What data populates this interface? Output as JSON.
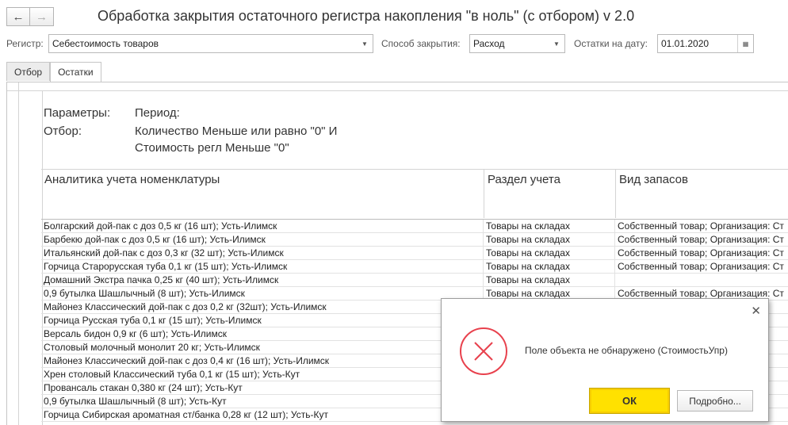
{
  "window": {
    "title": "Обработка закрытия остаточного регистра накопления \"в ноль\" (с отбором) v 2.0",
    "back_icon": "←",
    "forward_icon": "→"
  },
  "form": {
    "register_label": "Регистр:",
    "register_value": "Себестоимость товаров",
    "method_label": "Способ закрытия:",
    "method_value": "Расход",
    "date_label": "Остатки на дату:",
    "date_value": "01.01.2020",
    "dropdown_icon": "▼",
    "calendar_icon": "▦"
  },
  "tabs": [
    {
      "label": "Отбор"
    },
    {
      "label": "Остатки"
    }
  ],
  "report": {
    "params_label": "Параметры:",
    "period_label": "Период:",
    "filter_label": "Отбор:",
    "filter_line1": "Количество Меньше или равно \"0\" И",
    "filter_line2": "Стоимость регл Меньше \"0\"",
    "columns": [
      "Аналитика учета номенклатуры",
      "Раздел учета",
      "Вид запасов"
    ],
    "rows": [
      [
        "Болгарский дой-пак с доз 0,5 кг (16 шт); Усть-Илимск",
        "Товары на складах",
        "Собственный товар; Организация: Ст"
      ],
      [
        "Барбекю дой-пак с доз 0,5 кг (16 шт); Усть-Илимск",
        "Товары на складах",
        "Собственный товар; Организация: Ст"
      ],
      [
        "Итальянский дой-пак с доз 0,3 кг (32 шт); Усть-Илимск",
        "Товары на складах",
        "Собственный товар; Организация: Ст"
      ],
      [
        "Горчица Старорусская туба 0,1 кг (15 шт); Усть-Илимск",
        "Товары на складах",
        "Собственный товар; Организация: Ст"
      ],
      [
        "Домашний Экстра пачка 0,25 кг (40 шт); Усть-Илимск",
        "Товары на складах",
        ""
      ],
      [
        "0,9 бутылка Шашлычный (8 шт); Усть-Илимск",
        "Товары на складах",
        "Собственный товар; Организация: Ст"
      ],
      [
        "Майонез Классический дой-пак с доз 0,2 кг (32шт); Усть-Илимск",
        "",
        ""
      ],
      [
        "Горчица Русская туба 0,1 кг (15 шт); Усть-Илимск",
        "",
        ""
      ],
      [
        "Версаль бидон 0,9 кг (6 шт); Усть-Илимск",
        "",
        ""
      ],
      [
        "Столовый молочный монолит 20 кг; Усть-Илимск",
        "",
        ""
      ],
      [
        "Майонез Классический дой-пак с доз 0,4 кг (16 шт); Усть-Илимск",
        "",
        ""
      ],
      [
        "Хрен столовый Классический туба 0,1 кг (15 шт); Усть-Кут",
        "",
        ""
      ],
      [
        "Провансаль стакан 0,380 кг (24 шт); Усть-Кут",
        "",
        ""
      ],
      [
        "0,9 бутылка Шашлычный (8 шт); Усть-Кут",
        "",
        ""
      ],
      [
        "Горчица Сибирская ароматная ст/банка 0,28 кг (12 шт); Усть-Кут",
        "",
        ""
      ]
    ]
  },
  "dialog": {
    "message": "Поле объекта не обнаружено (СтоимостьУпр)",
    "ok_label": "ОК",
    "details_label": "Подробно...",
    "close_icon": "✕",
    "error_color": "#e8414d"
  }
}
